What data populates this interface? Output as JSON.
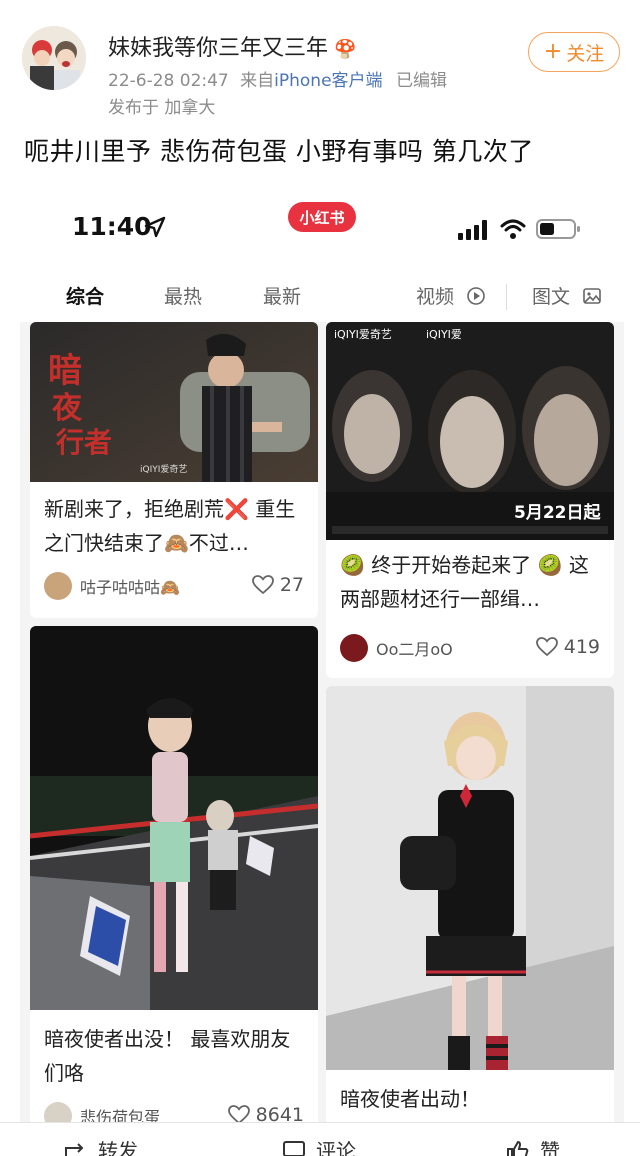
{
  "post": {
    "username": "妹妹我等你三年又三年",
    "badge_icon": "mushroom-icon",
    "date": "22-6-28 02:47",
    "source_prefix": "来自",
    "source": "iPhone客户端",
    "edited": "已编辑",
    "location": "发布于 加拿大",
    "follow_label": "关注",
    "text": "呃井川里予 悲伤荷包蛋 小野有事吗 第几次了"
  },
  "phone": {
    "time": "11:40",
    "app_name": "小红书",
    "tabs": [
      {
        "label": "综合"
      },
      {
        "label": "最热"
      },
      {
        "label": "最新"
      },
      {
        "label": "视频"
      },
      {
        "label": "图文"
      }
    ]
  },
  "feed": {
    "cards": [
      {
        "title": "新剧来了，拒绝剧荒❌ 重生之门快结束了🙈不过…",
        "author": "咕子咕咕咕🙈",
        "likes": "27",
        "poster_text": "暗夜行者",
        "poster_brand": "iQIYI爱奇艺"
      },
      {
        "title": "🥝 终于开始卷起来了 🥝 这两部题材还行一部缉…",
        "author": "Oo二月oO",
        "likes": "419",
        "poster_brand": "iQIYI爱奇艺",
        "poster_date": "5月22日起"
      },
      {
        "title": "暗夜使者出没！ 最喜欢朋友们咯",
        "author": "悲伤荷包蛋",
        "likes": "8641"
      },
      {
        "title": "暗夜使者出动！",
        "author": "",
        "likes": ""
      }
    ]
  },
  "actions": {
    "repost": "转发",
    "comment": "评论",
    "like": "赞"
  },
  "colors": {
    "follow_accent": "#f08a2c",
    "app_badge": "#e8323f",
    "link_blue": "#4a74b5"
  }
}
